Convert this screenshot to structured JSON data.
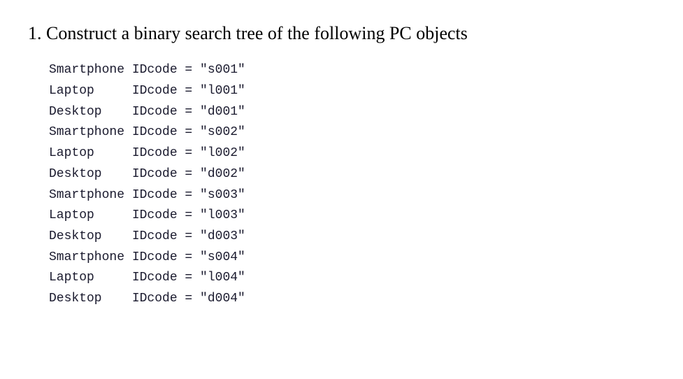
{
  "heading": "1. Construct a binary search tree of the following PC objects",
  "items": [
    {
      "type": "Smartphone",
      "idcode": "s001"
    },
    {
      "type": "Laptop",
      "idcode": "l001"
    },
    {
      "type": "Desktop",
      "idcode": "d001"
    },
    {
      "type": "Smartphone",
      "idcode": "s002"
    },
    {
      "type": "Laptop",
      "idcode": "l002"
    },
    {
      "type": "Desktop",
      "idcode": "d002"
    },
    {
      "type": "Smartphone",
      "idcode": "s003"
    },
    {
      "type": "Laptop",
      "idcode": "l003"
    },
    {
      "type": "Desktop",
      "idcode": "d003"
    },
    {
      "type": "Smartphone",
      "idcode": "s004"
    },
    {
      "type": "Laptop",
      "idcode": "l004"
    },
    {
      "type": "Desktop",
      "idcode": "d004"
    }
  ]
}
